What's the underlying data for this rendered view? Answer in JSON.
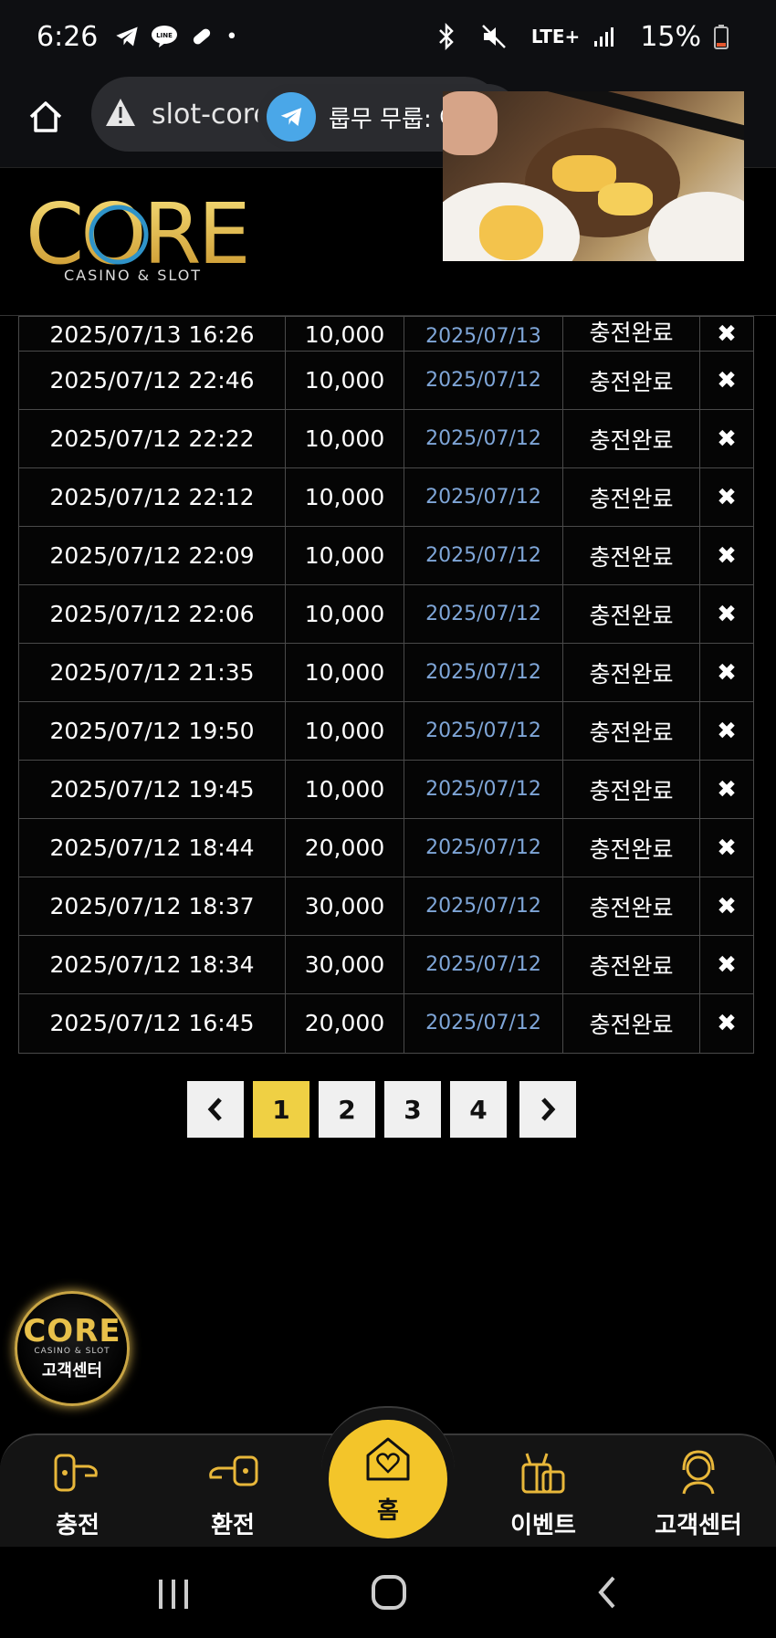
{
  "status_bar": {
    "time": "6:26",
    "dot": "•",
    "lte": "LTE+",
    "battery": "15%"
  },
  "browser": {
    "url": "slot-core",
    "overlay_text": "룹무 무룹: 여기"
  },
  "site": {
    "logo_text": "CORE",
    "logo_subtitle": "CASINO & SLOT"
  },
  "colors": {
    "accent": "#efd044",
    "link": "#7fa6d8",
    "background": "#000000"
  },
  "table": {
    "rows": [
      {
        "date": "2025/07/13 16:26",
        "amount": "10,000",
        "processed": "2025/07/13",
        "status": "충전완료"
      },
      {
        "date": "2025/07/12 22:46",
        "amount": "10,000",
        "processed": "2025/07/12",
        "status": "충전완료"
      },
      {
        "date": "2025/07/12 22:22",
        "amount": "10,000",
        "processed": "2025/07/12",
        "status": "충전완료"
      },
      {
        "date": "2025/07/12 22:12",
        "amount": "10,000",
        "processed": "2025/07/12",
        "status": "충전완료"
      },
      {
        "date": "2025/07/12 22:09",
        "amount": "10,000",
        "processed": "2025/07/12",
        "status": "충전완료"
      },
      {
        "date": "2025/07/12 22:06",
        "amount": "10,000",
        "processed": "2025/07/12",
        "status": "충전완료"
      },
      {
        "date": "2025/07/12 21:35",
        "amount": "10,000",
        "processed": "2025/07/12",
        "status": "충전완료"
      },
      {
        "date": "2025/07/12 19:50",
        "amount": "10,000",
        "processed": "2025/07/12",
        "status": "충전완료"
      },
      {
        "date": "2025/07/12 19:45",
        "amount": "10,000",
        "processed": "2025/07/12",
        "status": "충전완료"
      },
      {
        "date": "2025/07/12 18:44",
        "amount": "20,000",
        "processed": "2025/07/12",
        "status": "충전완료"
      },
      {
        "date": "2025/07/12 18:37",
        "amount": "30,000",
        "processed": "2025/07/12",
        "status": "충전완료"
      },
      {
        "date": "2025/07/12 18:34",
        "amount": "30,000",
        "processed": "2025/07/12",
        "status": "충전완료"
      },
      {
        "date": "2025/07/12 16:45",
        "amount": "20,000",
        "processed": "2025/07/12",
        "status": "충전완료"
      }
    ],
    "delete_symbol": "✖"
  },
  "pagination": {
    "prev": "‹",
    "pages": [
      "1",
      "2",
      "3",
      "4"
    ],
    "active_page": "1",
    "next": "›"
  },
  "cs_badge": {
    "logo": "CORE",
    "sub": "CASINO & SLOT",
    "label": "고객센터"
  },
  "bottom_nav": {
    "charge": "충전",
    "exchange": "환전",
    "home": "홈",
    "event": "이벤트",
    "support": "고객센터"
  }
}
